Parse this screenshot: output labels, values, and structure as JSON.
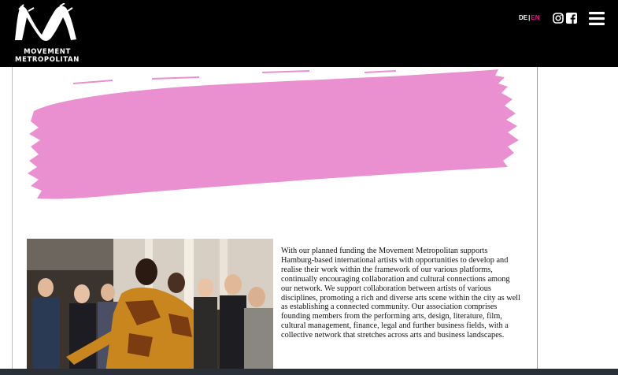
{
  "brand": {
    "name_line1": "MOVEMENT",
    "name_line2": "METROPOLITAN"
  },
  "language": {
    "de": "DE",
    "separator": "|",
    "en": "EN",
    "active": "EN"
  },
  "colors": {
    "header_bg": "#000000",
    "accent": "#e0148c",
    "brush": "#ea8fd0"
  },
  "icons": [
    "instagram-icon",
    "facebook-icon",
    "hamburger-menu-icon"
  ],
  "main": {
    "body_text": "With our planned funding the Movement Metropolitan supports Hamburg-based international artists with opportunities to develop and realise their work within the framework of our various platforms, continually encouraging collaboration and cultural connections among our network. We support collaboration between artists of various disciplines, promoting a rich and diverse arts scene within the city as well as establishing a connected community. Our association comprises founding members from the performing arts, design, literature, film, cultural management, finance, legal and further business fields, with a collective network that stretches across arts and business landscapes."
  }
}
